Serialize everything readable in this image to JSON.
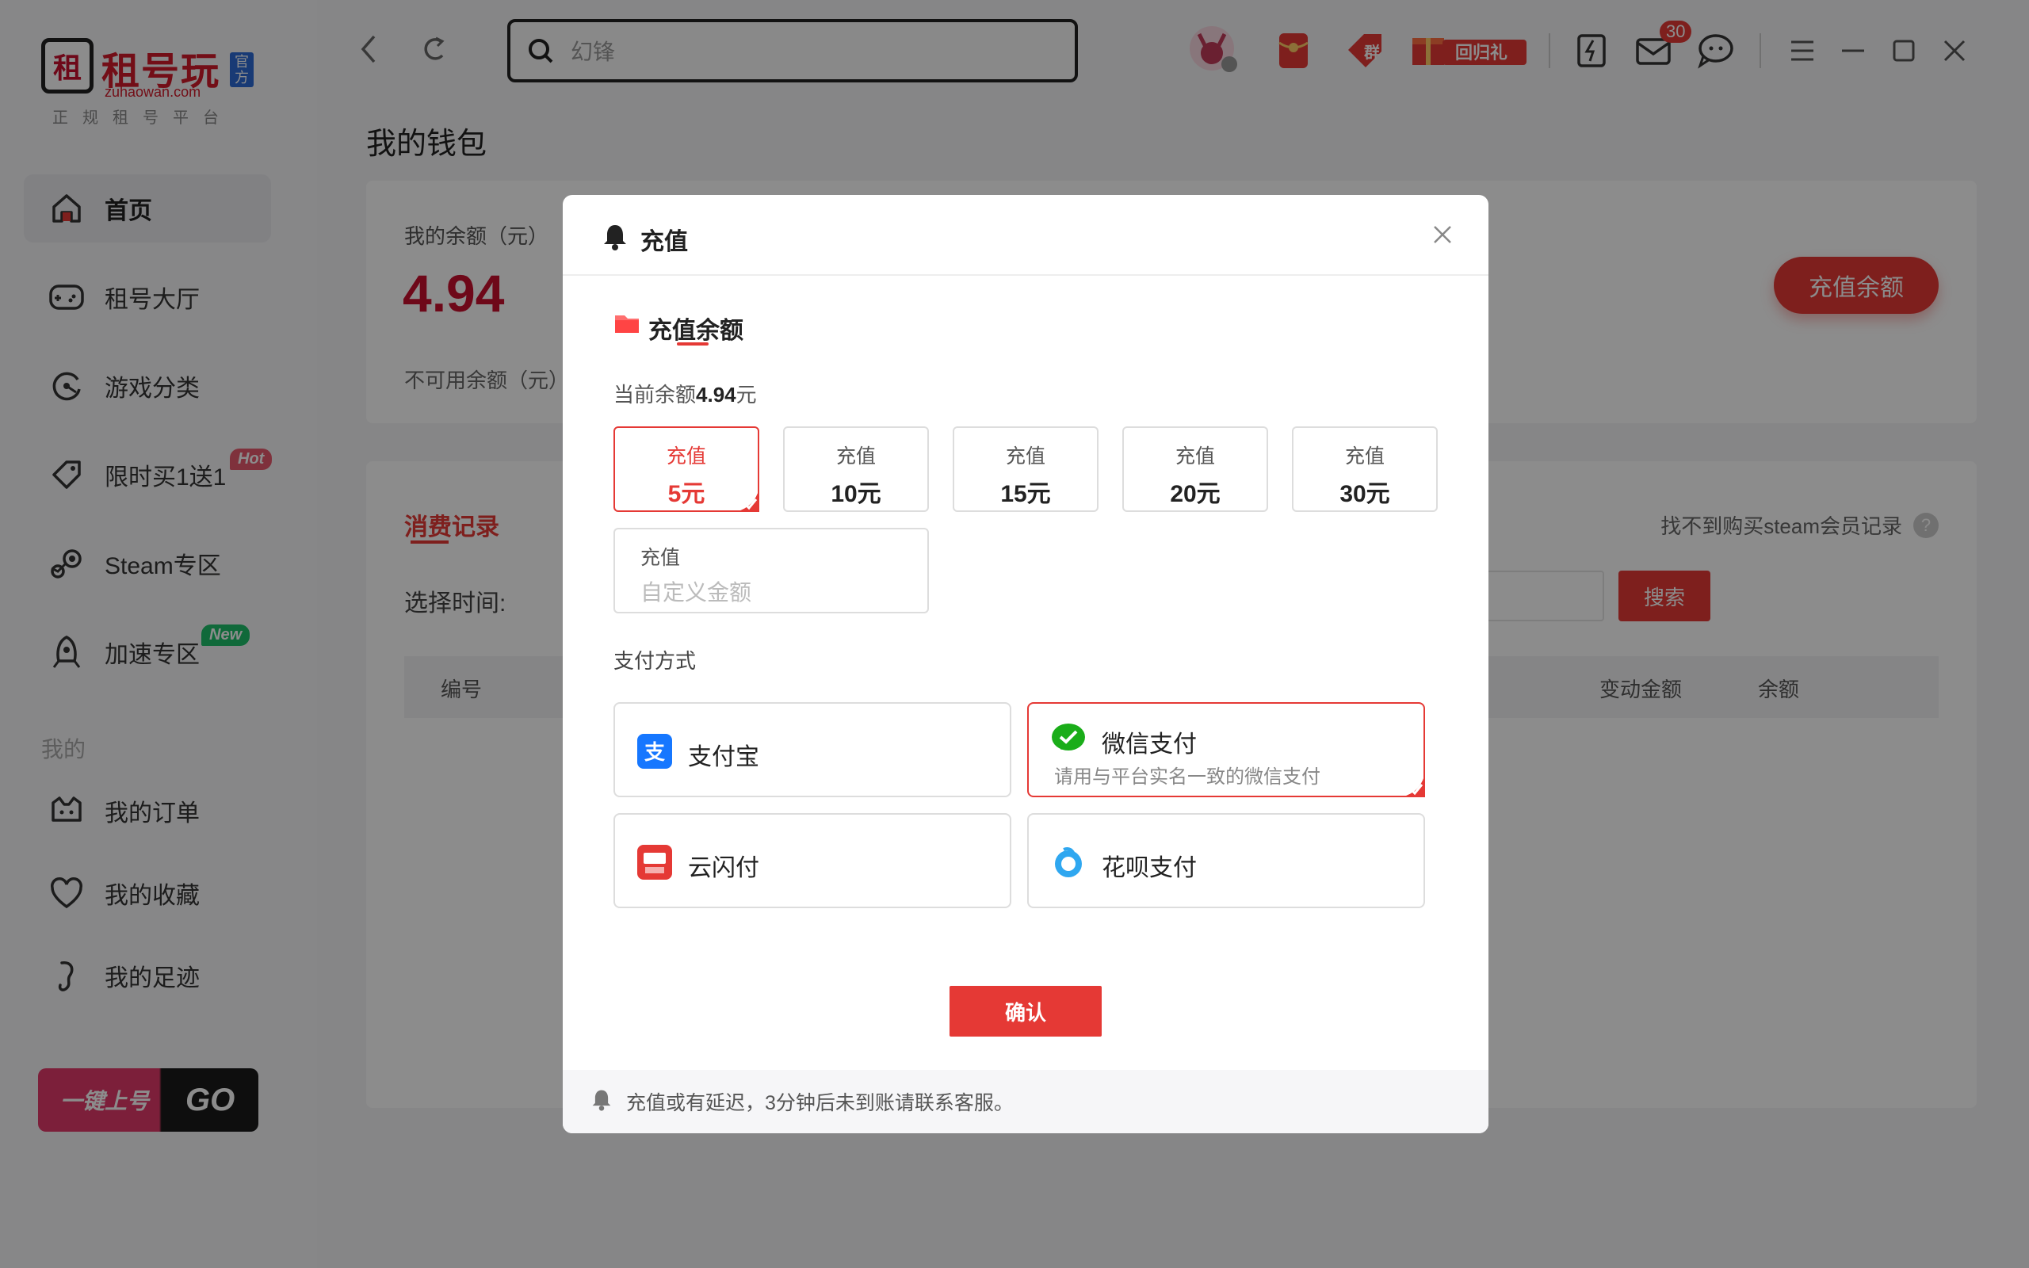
{
  "brand": {
    "name": "租号玩",
    "badge": "官方",
    "site": "zuhaowan.com",
    "tagline": "正规租号平台"
  },
  "sidebar": {
    "items": [
      {
        "label": "首页",
        "icon": "home-icon"
      },
      {
        "label": "租号大厅",
        "icon": "gamepad-icon"
      },
      {
        "label": "游戏分类",
        "icon": "category-icon"
      },
      {
        "label": "限时买1送1",
        "icon": "tag-icon",
        "tag": "Hot"
      },
      {
        "label": "Steam专区",
        "icon": "steam-icon"
      },
      {
        "label": "加速专区",
        "icon": "rocket-icon",
        "tag": "New"
      }
    ],
    "section_title": "我的",
    "my_items": [
      {
        "label": "我的订单",
        "icon": "order-icon"
      },
      {
        "label": "我的收藏",
        "icon": "heart-icon"
      },
      {
        "label": "我的足迹",
        "icon": "footprint-icon"
      }
    ],
    "banner": {
      "text": "一键上号",
      "go": "GO"
    }
  },
  "topbar": {
    "search_value": "幻锋",
    "gift_label": "回归礼",
    "group_label": "群",
    "mail_badge": "30"
  },
  "wallet": {
    "page_title": "我的钱包",
    "balance_label": "我的余额（元）",
    "balance_value": "4.94",
    "unavailable_label": "不可用余额（元）",
    "recharge_button": "充值余额",
    "tab_consume": "消费记录",
    "steam_help": "找不到购买steam会员记录",
    "time_label": "选择时间:",
    "search_button": "搜索",
    "columns": {
      "id": "编号",
      "change": "变动金额",
      "balance": "余额"
    }
  },
  "modal": {
    "title": "充值",
    "section_title": "充值余额",
    "current_prefix": "当前余额",
    "current_value": "4.94",
    "current_suffix": "元",
    "amounts": [
      {
        "top": "充值",
        "value": "5元",
        "selected": true
      },
      {
        "top": "充值",
        "value": "10元",
        "selected": false
      },
      {
        "top": "充值",
        "value": "15元",
        "selected": false
      },
      {
        "top": "充值",
        "value": "20元",
        "selected": false
      },
      {
        "top": "充值",
        "value": "30元",
        "selected": false
      }
    ],
    "custom_label": "充值",
    "custom_placeholder": "自定义金额",
    "pay_title": "支付方式",
    "payments": [
      {
        "name": "支付宝",
        "icon": "alipay-icon",
        "desc": "",
        "selected": false
      },
      {
        "name": "微信支付",
        "icon": "wechat-pay-icon",
        "desc": "请用与平台实名一致的微信支付",
        "selected": true
      },
      {
        "name": "云闪付",
        "icon": "unionpay-icon",
        "desc": "",
        "selected": false
      },
      {
        "name": "花呗支付",
        "icon": "huabei-icon",
        "desc": "",
        "selected": false
      }
    ],
    "confirm": "确认",
    "footer_note": "充值或有延迟，3分钟后未到账请联系客服。"
  },
  "colors": {
    "accent": "#e53935",
    "brand_red": "#c8102e",
    "hot": "#e85a6e",
    "new": "#1ec06a"
  }
}
